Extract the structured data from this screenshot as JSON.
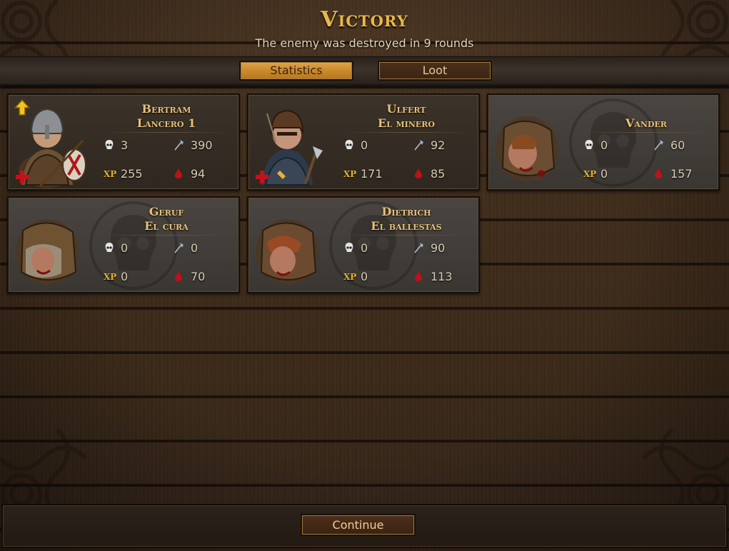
{
  "header": {
    "title": "Victory",
    "subtitle": "The enemy was destroyed in 9 rounds"
  },
  "tabs": [
    {
      "label": "Statistics",
      "active": true
    },
    {
      "label": "Loot",
      "active": false
    }
  ],
  "units": [
    {
      "name_line1": "Bertram",
      "name_line2": "Lancero 1",
      "kills": "3",
      "damage": "390",
      "xp": "255",
      "hp": "94",
      "status": "alive",
      "level_up": true,
      "wounded": true
    },
    {
      "name_line1": "Ulfert",
      "name_line2": "El minero",
      "kills": "0",
      "damage": "92",
      "xp": "171",
      "hp": "85",
      "status": "alive",
      "level_up": false,
      "wounded": true
    },
    {
      "name_line1": "Vander",
      "name_line2": "",
      "kills": "0",
      "damage": "60",
      "xp": "0",
      "hp": "157",
      "status": "dead"
    },
    {
      "name_line1": "Geruf",
      "name_line2": "El cura",
      "kills": "0",
      "damage": "0",
      "xp": "0",
      "hp": "70",
      "status": "dead"
    },
    {
      "name_line1": "Dietrich",
      "name_line2": "El ballestas",
      "kills": "0",
      "damage": "90",
      "xp": "0",
      "hp": "113",
      "status": "dead"
    }
  ],
  "stat_labels": {
    "xp": "XP"
  },
  "icons": {
    "kills": "skull-icon",
    "damage": "axe-icon",
    "xp": "xp-icon",
    "hp": "blood-drop-icon",
    "level_up": "arrow-up-icon",
    "wounded": "red-cross-icon"
  },
  "footer": {
    "continue_label": "Continue"
  },
  "colors": {
    "gold": "#e8b84a",
    "accent_tab": "#c98a2e",
    "wound_red": "#c8101a"
  }
}
